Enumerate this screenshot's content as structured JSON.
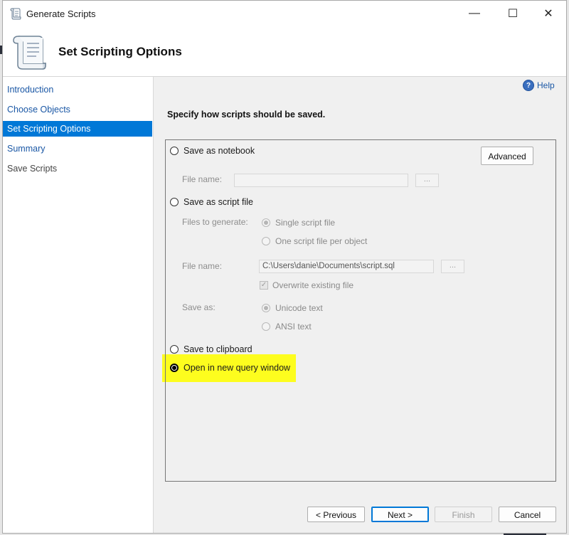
{
  "window": {
    "title": "Generate Scripts",
    "controls": {
      "minimize": "—",
      "maximize": "☐",
      "close": "✕"
    }
  },
  "header": {
    "title": "Set Scripting Options",
    "icon": "scroll-icon"
  },
  "nav": {
    "items": [
      {
        "label": "Introduction",
        "state": "link"
      },
      {
        "label": "Choose Objects",
        "state": "link"
      },
      {
        "label": "Set Scripting Options",
        "state": "selected"
      },
      {
        "label": "Summary",
        "state": "link"
      },
      {
        "label": "Save Scripts",
        "state": "disabled"
      }
    ]
  },
  "help": {
    "label": "Help",
    "icon_glyph": "?"
  },
  "main": {
    "instruction": "Specify how scripts should be saved.",
    "save_notebook": {
      "label": "Save as notebook",
      "file_name_label": "File name:",
      "file_name_value": "",
      "browse": "..."
    },
    "advanced_button": "Advanced",
    "save_script_file": {
      "label": "Save as script file",
      "files_to_generate_label": "Files to generate:",
      "single_file": "Single script file",
      "per_object": "One script file per object",
      "file_name_label": "File name:",
      "file_name_value": "C:\\Users\\danie\\Documents\\script.sql",
      "browse": "...",
      "overwrite_label": "Overwrite existing file",
      "save_as_label": "Save as:",
      "unicode": "Unicode text",
      "ansi": "ANSI text"
    },
    "save_clipboard": {
      "label": "Save to clipboard"
    },
    "open_query_window": {
      "label": "Open in new query window",
      "selected": true
    }
  },
  "footer": {
    "previous": "< Previous",
    "next": "Next >",
    "finish": "Finish",
    "cancel": "Cancel"
  },
  "colors": {
    "accent": "#0078d7",
    "highlight": "#fdfd1e",
    "link": "#1a57a5"
  }
}
